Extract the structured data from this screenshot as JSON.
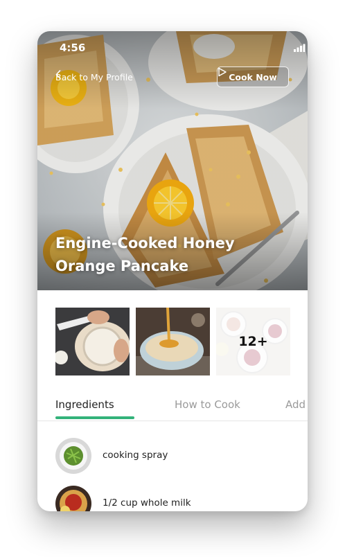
{
  "status": {
    "time": "4:56"
  },
  "header": {
    "back_label": "Back to My Profile",
    "cook_label": "Cook Now"
  },
  "recipe": {
    "title_line1": "Engine-Cooked Honey",
    "title_line2": "Orange Pancake"
  },
  "gallery": {
    "more_count": "12+"
  },
  "tabs": [
    {
      "label": "Ingredients"
    },
    {
      "label": "How to Cook"
    },
    {
      "label": "Add"
    }
  ],
  "ingredients": [
    {
      "label": "cooking spray"
    },
    {
      "label": "1/2 cup whole milk"
    }
  ],
  "colors": {
    "accent": "#33b27a",
    "text_primary": "#222222",
    "text_muted": "#9a9a9a"
  }
}
